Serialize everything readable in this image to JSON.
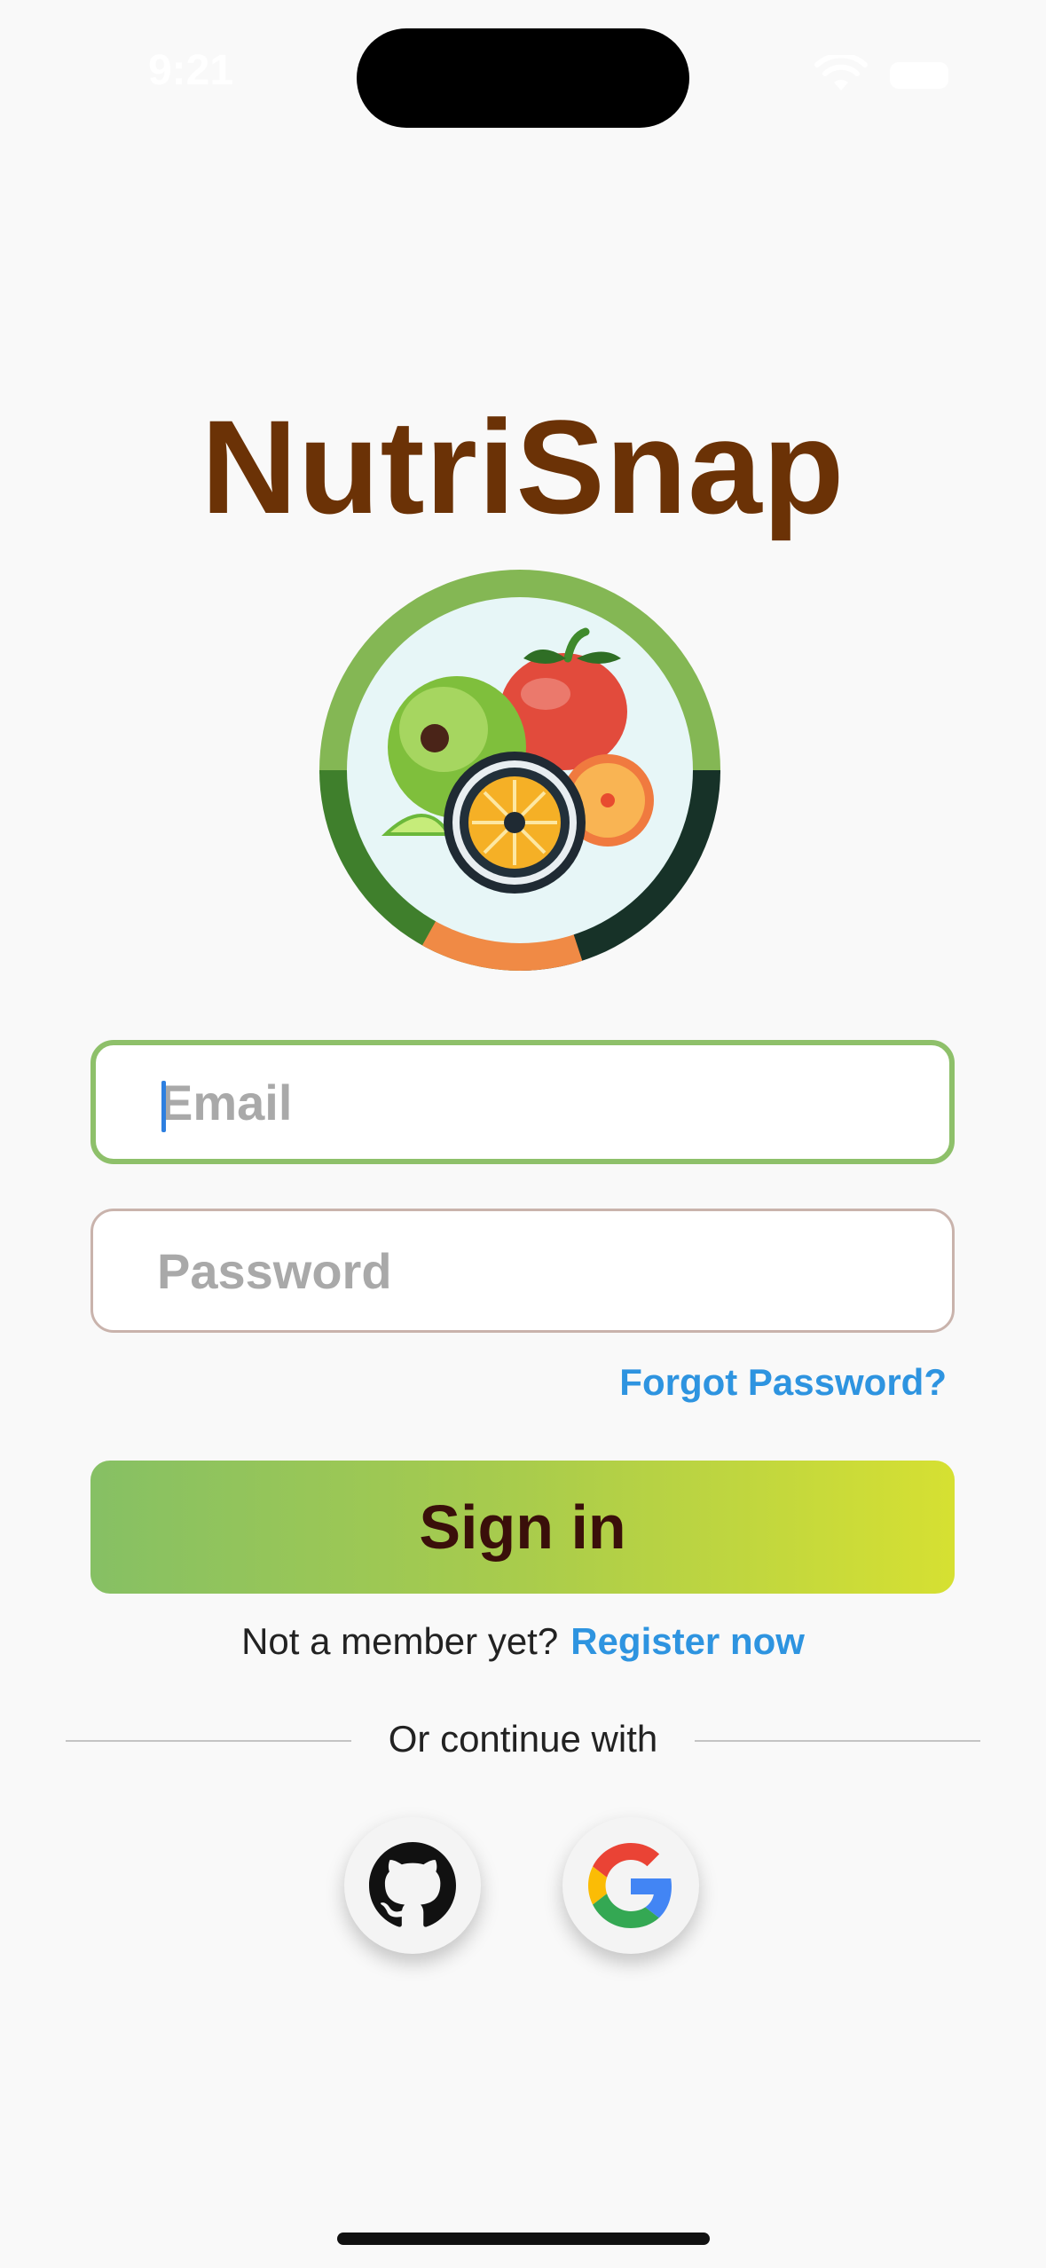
{
  "status_bar": {
    "time": "9:21",
    "wifi_icon": "wifi-icon",
    "battery_icon": "battery-icon"
  },
  "app": {
    "title": "NutriSnap",
    "logo_icon": "fruit-logo-icon"
  },
  "login_form": {
    "email_placeholder": "Email",
    "email_value": "",
    "password_placeholder": "Password",
    "password_value": "",
    "forgot_password_label": "Forgot Password?",
    "sign_in_label": "Sign in"
  },
  "register": {
    "prompt": "Not a member yet?",
    "link_label": "Register now"
  },
  "social": {
    "divider_label": "Or continue with",
    "providers": [
      {
        "name": "GitHub",
        "icon": "github-icon"
      },
      {
        "name": "Google",
        "icon": "google-icon"
      }
    ]
  },
  "colors": {
    "title": "#6b3206",
    "accent_link": "#2e94e0",
    "focused_border": "#8ec06a",
    "button_gradient_start": "#86c064",
    "button_gradient_end": "#d6e032",
    "button_text": "#3a0f0a"
  }
}
